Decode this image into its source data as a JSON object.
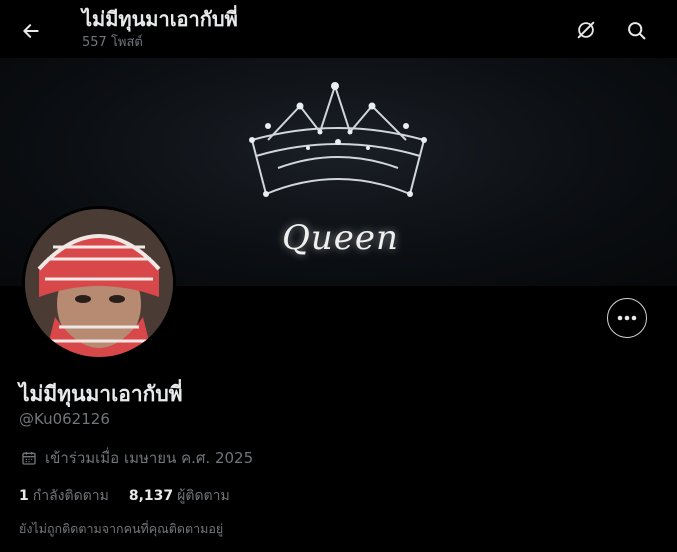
{
  "header": {
    "title": "ไม่มีทุนมาเอากับพี่",
    "post_count": "557 โพสต์"
  },
  "banner": {
    "text": "Queen"
  },
  "profile": {
    "display_name": "ไม่มีทุนมาเอากับพี่",
    "handle": "@Ku062126",
    "joined": "เข้าร่วมเมื่อ เมษายน ค.ศ. 2025",
    "following_count": "1",
    "following_label": "กำลังติดตาม",
    "followers_count": "8,137",
    "followers_label": "ผู้ติดตาม",
    "not_followed_note": "ยังไม่ถูกติดตามจากคนที่คุณติดตามอยู่"
  },
  "icons": {
    "back": "arrow-left-icon",
    "grok": "grok-icon",
    "search": "search-icon",
    "more": "more-horizontal-icon",
    "calendar": "calendar-icon"
  },
  "colors": {
    "background": "#000000",
    "primary_text": "#e7e9ea",
    "secondary_text": "#71767b"
  }
}
